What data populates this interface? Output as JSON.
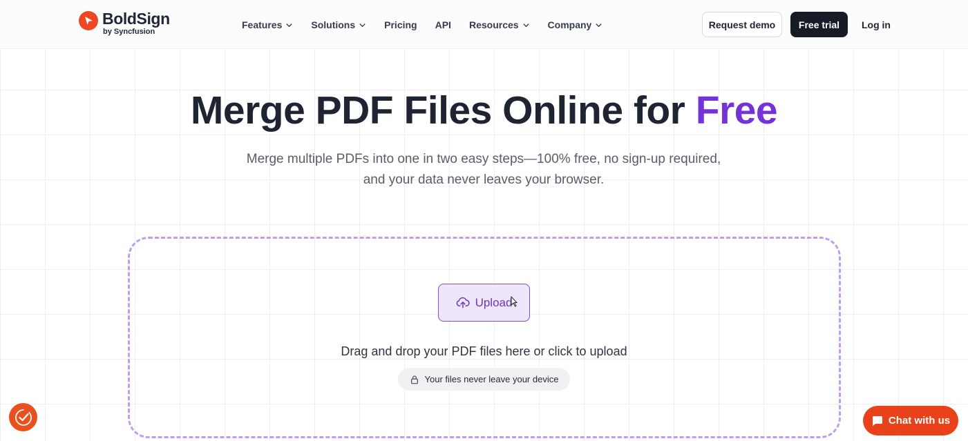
{
  "brand": {
    "name": "BoldSign",
    "byline": "by Syncfusion"
  },
  "nav": [
    {
      "label": "Features",
      "has_dropdown": true
    },
    {
      "label": "Solutions",
      "has_dropdown": true
    },
    {
      "label": "Pricing",
      "has_dropdown": false
    },
    {
      "label": "API",
      "has_dropdown": false
    },
    {
      "label": "Resources",
      "has_dropdown": true
    },
    {
      "label": "Company",
      "has_dropdown": true
    }
  ],
  "header_actions": {
    "demo": "Request demo",
    "trial": "Free trial",
    "login": "Log in"
  },
  "hero": {
    "title_main": "Merge PDF Files Online for ",
    "title_accent": "Free",
    "subtitle_line1": "Merge multiple PDFs into one in two easy steps—100% free, no sign-up required,",
    "subtitle_line2": "and your data never leaves your browser."
  },
  "upload": {
    "button_label": "Upload",
    "drag_text": "Drag and drop your PDF files here or click to upload",
    "privacy_text": "Your files never leave your device"
  },
  "chat": {
    "label": "Chat with us"
  },
  "colors": {
    "accent": "#7433d9",
    "brand": "#ef4623",
    "dark": "#161b26",
    "chat": "#e9421a"
  },
  "icons": {
    "upload": "cloud-upload-icon",
    "privacy": "lock-icon",
    "chat": "chat-bubble-icon",
    "badge": "check-badge-icon"
  }
}
